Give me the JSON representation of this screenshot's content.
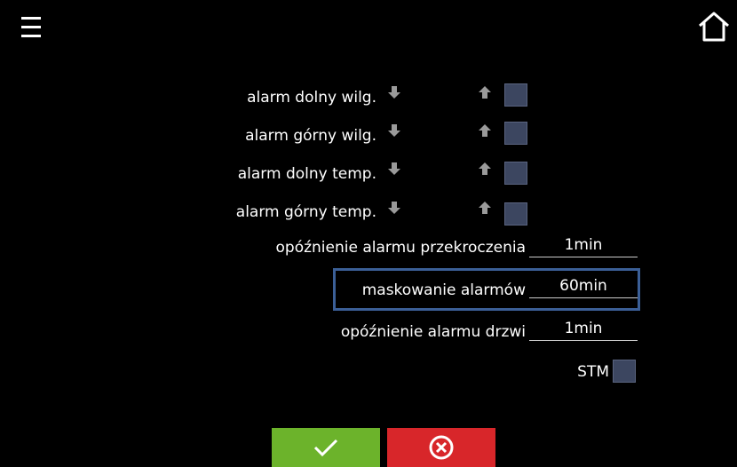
{
  "icons": {
    "menu": "hamburger-menu-icon",
    "home": "home-icon",
    "down": "arrow-down-icon",
    "up": "arrow-up-icon",
    "confirm": "checkmark-icon",
    "cancel": "cancel-circle-x-icon"
  },
  "colors": {
    "background": "#000000",
    "checkbox": "#3c4660",
    "arrow": "#9a9a9a",
    "focus_frame": "#3b5f97",
    "confirm_button": "#6cb32b",
    "cancel_button": "#d8262a"
  },
  "alarms": [
    {
      "label": "alarm dolny wilg."
    },
    {
      "label": "alarm górny wilg."
    },
    {
      "label": "alarm dolny temp."
    },
    {
      "label": "alarm górny temp."
    }
  ],
  "fields": {
    "exceed_delay": {
      "label": "opóźnienie alarmu przekroczenia",
      "value": "1min"
    },
    "masking": {
      "label": "maskowanie alarmów",
      "value": "60min"
    },
    "door_delay": {
      "label": "opóźnienie alarmu drzwi",
      "value": "1min"
    }
  },
  "stm": {
    "label": "STM"
  }
}
